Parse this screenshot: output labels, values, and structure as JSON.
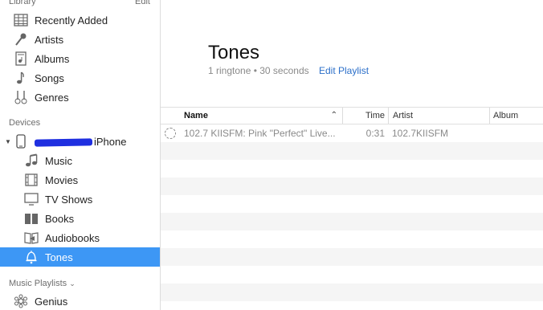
{
  "sidebar": {
    "library_header": "Library",
    "edit_label": "Edit",
    "library_items": [
      {
        "label": "Recently Added",
        "icon": "grid-icon"
      },
      {
        "label": "Artists",
        "icon": "microphone-icon"
      },
      {
        "label": "Albums",
        "icon": "album-icon"
      },
      {
        "label": "Songs",
        "icon": "music-note-icon"
      },
      {
        "label": "Genres",
        "icon": "guitars-icon"
      }
    ],
    "devices_header": "Devices",
    "device_name": "iPhone",
    "device_items": [
      {
        "label": "Music",
        "icon": "music-note-icon"
      },
      {
        "label": "Movies",
        "icon": "film-icon"
      },
      {
        "label": "TV Shows",
        "icon": "tv-icon"
      },
      {
        "label": "Books",
        "icon": "book-icon"
      },
      {
        "label": "Audiobooks",
        "icon": "audiobook-icon"
      },
      {
        "label": "Tones",
        "icon": "bell-icon",
        "selected": true
      }
    ],
    "playlists_header": "Music Playlists",
    "playlist_items": [
      {
        "label": "Genius",
        "icon": "genius-icon"
      }
    ]
  },
  "main": {
    "title": "Tones",
    "meta": "1 ringtone • 30 seconds",
    "edit_playlist": "Edit Playlist",
    "columns": {
      "name": "Name",
      "time": "Time",
      "artist": "Artist",
      "album": "Album"
    },
    "rows": [
      {
        "name": "102.7 KIISFM: Pink \"Perfect\" Live...",
        "time": "0:31",
        "artist": "102.7KIISFM",
        "album": ""
      }
    ]
  },
  "colors": {
    "selection": "#3d97f5",
    "link": "#2b6fc9",
    "redaction": "#1f2fe0"
  }
}
